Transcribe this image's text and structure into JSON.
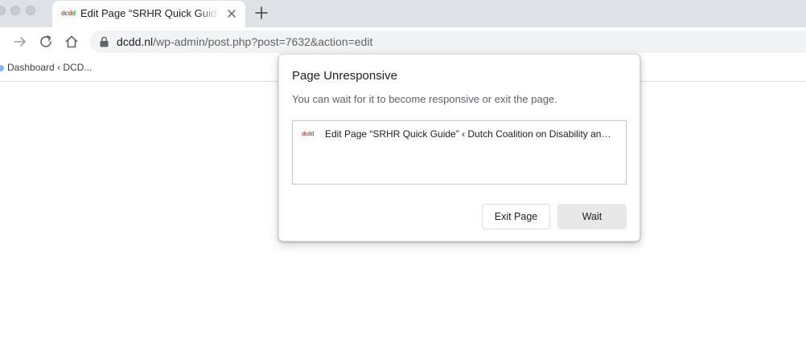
{
  "tab": {
    "title": "Edit Page “SRHR Quick Guide” ‹ Dutch Coalition on Disability and Development — WordPress",
    "favicon_text": [
      "d",
      "c",
      "d",
      "d"
    ]
  },
  "toolbar": {
    "url_host": "dcdd.nl",
    "url_path": "/wp-admin/post.php?post=7632&action=edit"
  },
  "bookmarks": {
    "items": [
      {
        "label": "Dashboard ‹ DCD..."
      }
    ]
  },
  "dialog": {
    "title": "Page Unresponsive",
    "message": "You can wait for it to become responsive or exit the page.",
    "pages": [
      {
        "label": "Edit Page “SRHR Quick Guide” ‹ Dutch Coalition on Disability and Development — WordPress"
      }
    ],
    "exit_label": "Exit Page",
    "wait_label": "Wait"
  },
  "colors": {
    "tabstrip": "#dee1e6",
    "omnibox": "#f1f3f4",
    "wait_button": "#e8e8e8"
  }
}
